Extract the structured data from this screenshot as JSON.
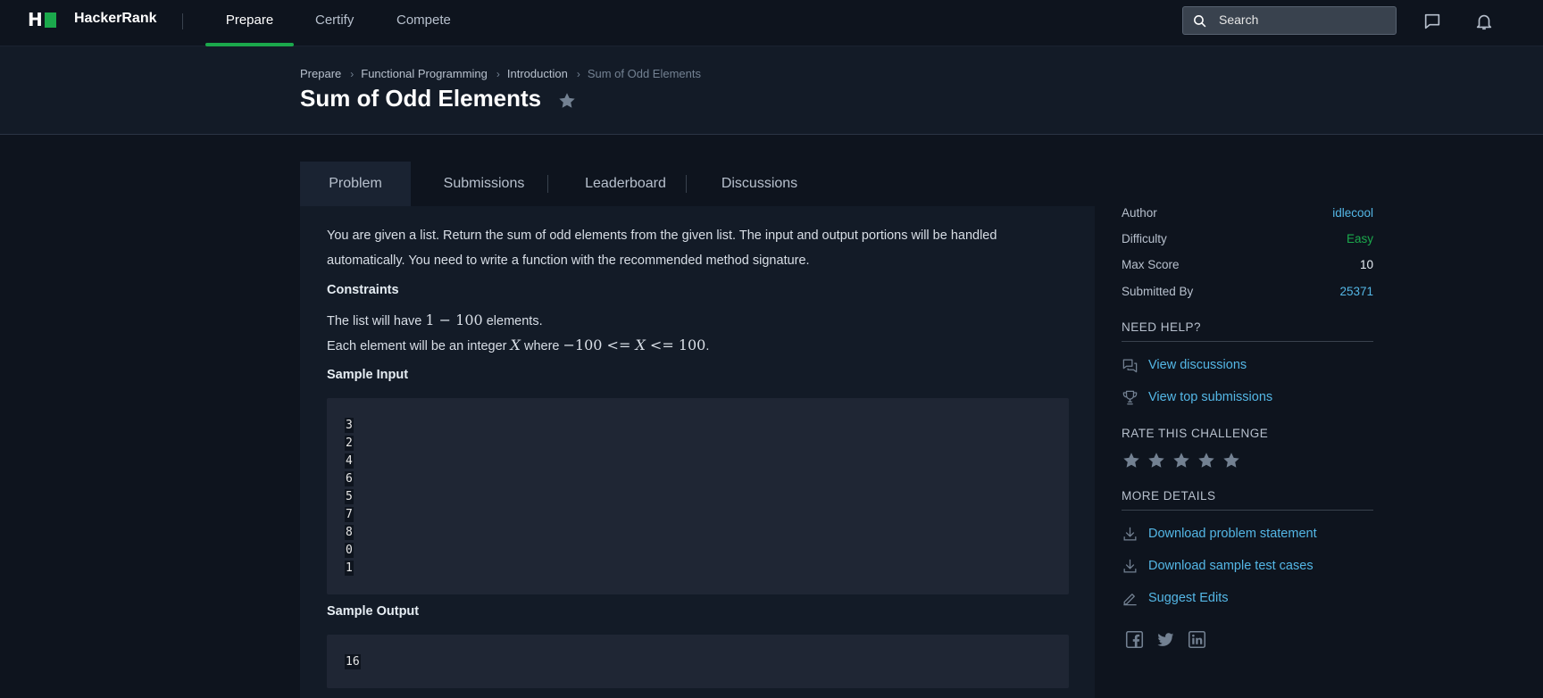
{
  "nav": {
    "brand": "HackerRank",
    "items": [
      {
        "label": "Prepare",
        "active": true
      },
      {
        "label": "Certify",
        "active": false
      },
      {
        "label": "Compete",
        "active": false
      }
    ],
    "search_placeholder": "Search",
    "icons": [
      "messages-icon",
      "notifications-bell-icon"
    ],
    "accent_color": "#1ba94c"
  },
  "breadcrumb": [
    "Prepare",
    "Functional Programming",
    "Introduction",
    "Sum of Odd Elements"
  ],
  "title": "Sum of Odd Elements",
  "tabs": [
    "Problem",
    "Submissions",
    "Leaderboard",
    "Discussions"
  ],
  "problem": {
    "intro_line1": "You are given a list. Return the sum of odd elements from the given list. The input and output portions will be handled",
    "intro_line2": "automatically. You need to write a function with the recommended method signature.",
    "constraints_heading": "Constraints",
    "constraint1_pre": "The list will have ",
    "constraint1_math": "1 − 100",
    "constraint1_post": " elements.",
    "constraint2_pre": "Each element will be an integer ",
    "constraint2_var": "X",
    "constraint2_mid": " where ",
    "constraint2_math_a": "−100 <= ",
    "constraint2_math_b": " <= 100",
    "constraint2_post": ".",
    "sample_input_heading": "Sample Input",
    "sample_input": [
      "3",
      "2",
      "4",
      "6",
      "5",
      "7",
      "8",
      "0",
      "1"
    ],
    "sample_output_heading": "Sample Output",
    "sample_output": [
      "16"
    ]
  },
  "details": {
    "author_label": "Author",
    "author": "idlecool",
    "difficulty_label": "Difficulty",
    "difficulty": "Easy",
    "difficulty_color": "#1ba94c",
    "max_score_label": "Max Score",
    "max_score": "10",
    "submitted_by_label": "Submitted By",
    "submitted_by": "25371"
  },
  "help": {
    "heading": "NEED HELP?",
    "view_discussions": "View discussions",
    "view_top_submissions": "View top submissions"
  },
  "rate": {
    "heading": "RATE THIS CHALLENGE",
    "stars_total": 5,
    "stars_filled": 0
  },
  "more": {
    "heading": "MORE DETAILS",
    "download_statement": "Download problem statement",
    "download_tests": "Download sample test cases",
    "suggest_edits": "Suggest Edits"
  },
  "social": [
    "facebook-icon",
    "twitter-icon",
    "linkedin-icon"
  ]
}
